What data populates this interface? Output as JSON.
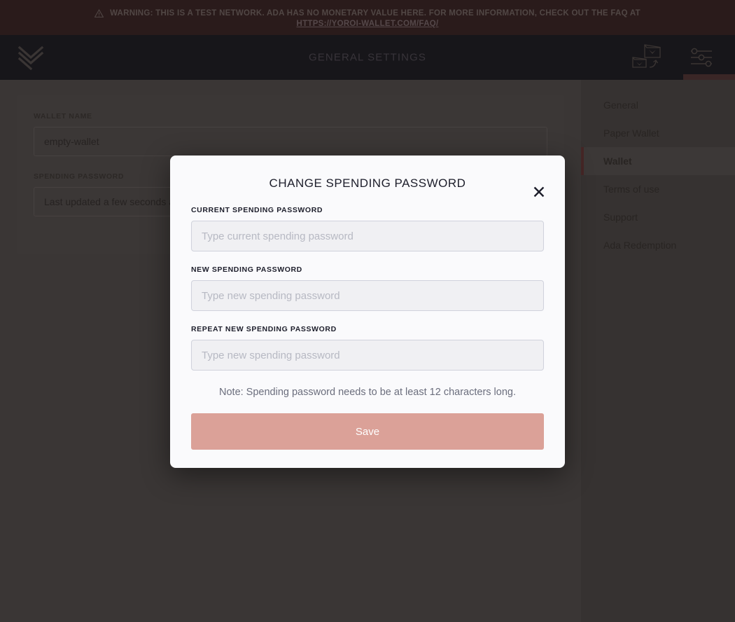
{
  "warning_banner": {
    "icon": "warning-triangle-icon",
    "text": "WARNING: THIS IS A TEST NETWORK. ADA HAS NO MONETARY VALUE HERE. FOR MORE INFORMATION, CHECK OUT THE FAQ AT",
    "link_text": "HTTPS://YOROI-WALLET.COM/FAQ/",
    "background_color": "#2a1b1b",
    "text_color": "#514745"
  },
  "topbar": {
    "logo_icon": "yoroi-logo-icon",
    "title": "GENERAL SETTINGS",
    "background_color": "#17161a",
    "actions": [
      {
        "icon": "wallet-switch-icon",
        "active": false
      },
      {
        "icon": "settings-sliders-icon",
        "active": true
      }
    ],
    "active_indicator_color": "#3a2626"
  },
  "settings_form": {
    "fields": [
      {
        "label": "WALLET NAME",
        "value": "empty-wallet",
        "name": "wallet-name"
      },
      {
        "label": "SPENDING PASSWORD",
        "value": "Last updated a few seconds ago",
        "name": "spending-password"
      }
    ]
  },
  "settings_menu": {
    "items": [
      {
        "label": "General",
        "active": false
      },
      {
        "label": "Paper Wallet",
        "active": false
      },
      {
        "label": "Wallet",
        "active": true
      },
      {
        "label": "Terms of use",
        "active": false
      },
      {
        "label": "Support",
        "active": false
      },
      {
        "label": "Ada Redemption",
        "active": false
      }
    ],
    "active_accent_color": "#452626"
  },
  "dialog": {
    "title": "CHANGE SPENDING PASSWORD",
    "close_icon": "close-icon",
    "close_glyph": "✕",
    "fields": [
      {
        "label": "CURRENT SPENDING PASSWORD",
        "placeholder": "Type current spending password",
        "value": ""
      },
      {
        "label": "NEW SPENDING PASSWORD",
        "placeholder": "Type new spending password",
        "value": ""
      },
      {
        "label": "REPEAT NEW SPENDING PASSWORD",
        "placeholder": "Type new spending password",
        "value": ""
      }
    ],
    "note": "Note: Spending password needs to be at least 12 characters long.",
    "save_label": "Save",
    "save_color": "#dba198",
    "background_color": "#fafafc"
  }
}
